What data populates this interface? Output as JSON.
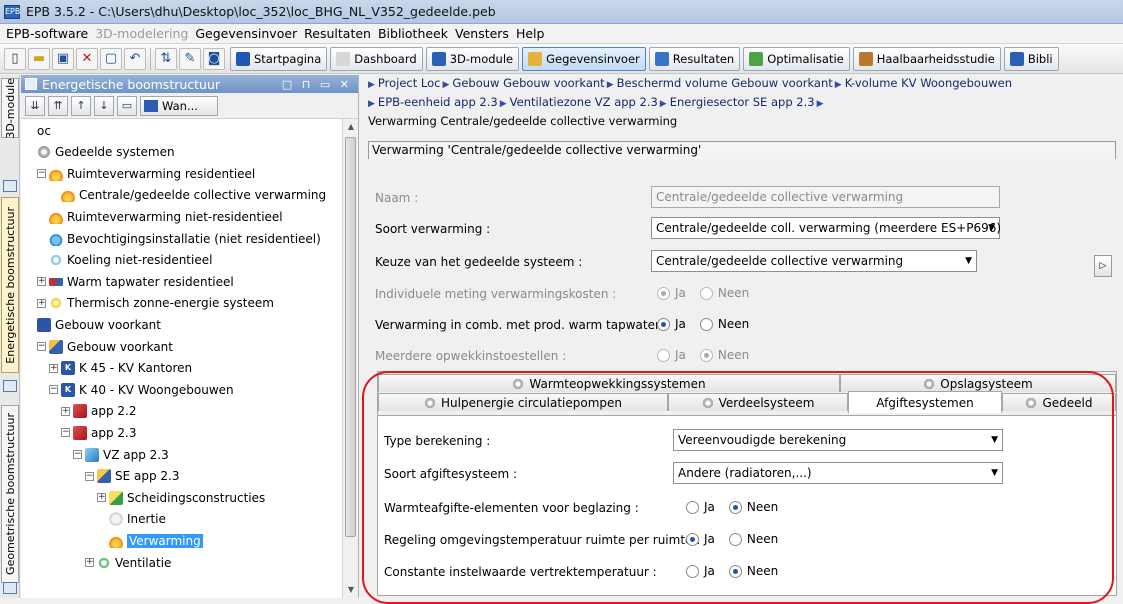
{
  "window": {
    "title": "EPB 3.5.2 - C:\\Users\\dhu\\Desktop\\loc_352\\loc_BHG_NL_V352_gedeelde.peb",
    "app_icon_text": "EPB"
  },
  "menubar": [
    {
      "label": "EPB-software",
      "enabled": true
    },
    {
      "label": "3D-modelering",
      "enabled": false
    },
    {
      "label": "Gegevensinvoer",
      "enabled": true
    },
    {
      "label": "Resultaten",
      "enabled": true
    },
    {
      "label": "Bibliotheek",
      "enabled": true
    },
    {
      "label": "Vensters",
      "enabled": true
    },
    {
      "label": "Help",
      "enabled": true
    }
  ],
  "toolbar": {
    "icons": [
      "new-file-icon",
      "open-folder-icon",
      "save-icon",
      "delete-icon",
      "window-icon",
      "undo-icon",
      "refresh-icon",
      "edit-icon",
      "view-icon"
    ],
    "buttons": [
      {
        "label": "Startpagina",
        "active": false,
        "icon_color": "#1f56b8"
      },
      {
        "label": "Dashboard",
        "active": false,
        "icon_color": "#d8d8d8"
      },
      {
        "label": "3D-module",
        "active": false,
        "icon_color": "#2b60b6"
      },
      {
        "label": "Gegevensinvoer",
        "active": true,
        "icon_color": "#e3b33a"
      },
      {
        "label": "Resultaten",
        "active": false,
        "icon_color": "#3a72c8"
      },
      {
        "label": "Optimalisatie",
        "active": false,
        "icon_color": "#4ea24a"
      },
      {
        "label": "Haalbaarheidsstudie",
        "active": false,
        "icon_color": "#b77a2a"
      },
      {
        "label": "Bibli",
        "active": false,
        "icon_color": "#2a5fb5"
      }
    ]
  },
  "side_tabs": {
    "top": "3D-module",
    "middle": "Energetische boomstructuur",
    "bottom": "Geometrische boomstructuur"
  },
  "tree_panel": {
    "title": "Energetische boomstructuur",
    "window_controls": "□ ⊓ ▭ ✕",
    "view_combo": "Wan...",
    "items": [
      {
        "label": "oc",
        "icon": "",
        "level": 0,
        "toggle": ""
      },
      {
        "label": "Gedeelde systemen",
        "icon": "gear",
        "level": 0,
        "toggle": ""
      },
      {
        "label": "Ruimteverwarming residentieel",
        "icon": "flame",
        "level": 1,
        "toggle": "−"
      },
      {
        "label": "Centrale/gedeelde collective verwarming",
        "icon": "flame",
        "level": 2,
        "toggle": ""
      },
      {
        "label": "Ruimteverwarming niet-residentieel",
        "icon": "flame",
        "level": 1,
        "toggle": ""
      },
      {
        "label": "Bevochtigingsinstallatie (niet residentieel)",
        "icon": "drop",
        "level": 1,
        "toggle": ""
      },
      {
        "label": "Koeling niet-residentieel",
        "icon": "snow",
        "level": 1,
        "toggle": ""
      },
      {
        "label": "Warm tapwater residentieel",
        "icon": "pipe",
        "level": 1,
        "toggle": "+"
      },
      {
        "label": "Thermisch zonne-energie systeem",
        "icon": "sun",
        "level": 1,
        "toggle": "+"
      },
      {
        "label": "Gebouw voorkant",
        "icon": "house",
        "level": 0,
        "toggle": ""
      },
      {
        "label": "Gebouw voorkant",
        "icon": "cube",
        "level": 1,
        "toggle": "−"
      },
      {
        "label": "K 45 - KV Kantoren",
        "icon": "kbox",
        "level": 2,
        "toggle": "+"
      },
      {
        "label": "K 40 - KV Woongebouwen",
        "icon": "kbox",
        "level": 2,
        "toggle": "−"
      },
      {
        "label": "app 2.2",
        "icon": "redcube",
        "level": 3,
        "toggle": "+"
      },
      {
        "label": "app 2.3",
        "icon": "redcube",
        "level": 3,
        "toggle": "−"
      },
      {
        "label": "VZ app 2.3",
        "icon": "vz",
        "level": 4,
        "toggle": "−"
      },
      {
        "label": "SE app 2.3",
        "icon": "se",
        "level": 5,
        "toggle": "−"
      },
      {
        "label": "Scheidingsconstructies",
        "icon": "wall",
        "level": 6,
        "toggle": "+"
      },
      {
        "label": "Inertie",
        "icon": "cloud",
        "level": 6,
        "toggle": ""
      },
      {
        "label": "Verwarming",
        "icon": "flame",
        "level": 6,
        "toggle": "",
        "selected": true
      },
      {
        "label": "Ventilatie",
        "icon": "vent",
        "level": 5,
        "toggle": "+"
      }
    ]
  },
  "breadcrumb": {
    "line1": [
      "Project Loc",
      "Gebouw Gebouw voorkant",
      "Beschermd volume Gebouw voorkant",
      "K-volume KV Woongebouwen"
    ],
    "line2": [
      "EPB-eenheid app 2.3",
      "Ventilatiezone VZ app 2.3",
      "Energiesector SE app 2.3"
    ],
    "line3": "Verwarming Centrale/gedeelde collective verwarming"
  },
  "section": {
    "header": "Verwarming 'Centrale/gedeelde collective verwarming'",
    "name_label": "Naam :",
    "name_value": "Centrale/gedeelde collective verwarming",
    "soort_label": "Soort verwarming :",
    "soort_value": "Centrale/gedeelde coll. verwarming (meerdere ES+P696)",
    "keuze_label": "Keuze van het gedeelde systeem :",
    "keuze_value": "Centrale/gedeelde collective verwarming",
    "meting_label": "Individuele meting verwarmingskosten :",
    "comb_label": "Verwarming in comb. met prod. warm tapwater :",
    "opwek_label": "Meerdere opwekkinstoestellen :",
    "radio_yes": "Ja",
    "radio_no": "Neen",
    "meting_selected": "Ja",
    "comb_selected": "Ja",
    "opwek_selected": "Neen"
  },
  "tabs": {
    "row1": [
      "Warmteopwekkingssystemen",
      "Opslagsysteem"
    ],
    "row2": [
      "Hulpenergie circulatiepompen",
      "Verdeelsysteem",
      "Afgiftesystemen",
      "Gedeeld"
    ],
    "active": "Afgiftesystemen"
  },
  "afgifte": {
    "type_label": "Type berekening :",
    "type_value": "Vereenvoudigde berekening",
    "soort_label": "Soort afgiftesysteem :",
    "soort_value": "Andere (radiatoren,...)",
    "beglazing_label": "Warmteafgifte-elementen voor beglazing :",
    "regeling_label": "Regeling omgevingstemperatuur ruimte per ruimte :",
    "constante_label": "Constante instelwaarde vertrektemperatuur :",
    "beglazing_selected": "Neen",
    "regeling_selected": "Ja",
    "constante_selected": "Neen"
  },
  "colors": {
    "highlight": "#e0161d",
    "selection": "#3399ff",
    "panel_header": "#7c9dcc"
  }
}
